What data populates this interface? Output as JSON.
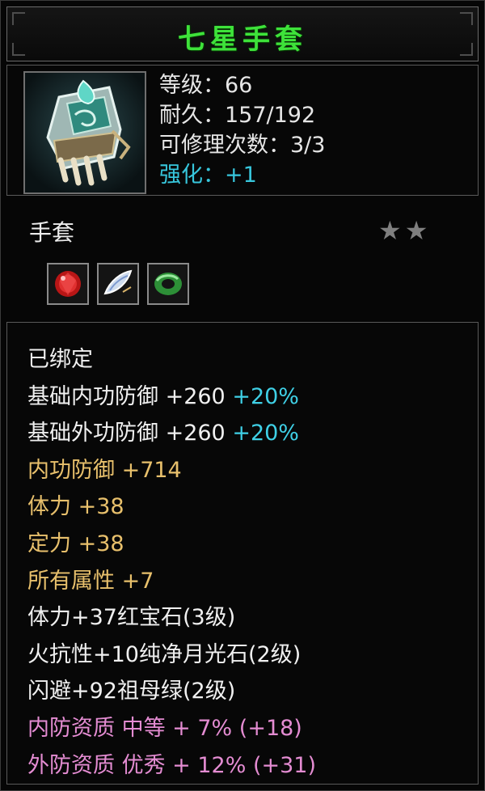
{
  "item": {
    "name": "七星手套",
    "icon": "gauntlet-icon",
    "level": "等级：66",
    "durability": "耐久：157/192",
    "repairs": "可修理次数：3/3",
    "enhance": "强化：+1",
    "type": "手套",
    "stars": "★★",
    "gems": [
      {
        "icon": "ruby-gem-icon",
        "color": "#d42222"
      },
      {
        "icon": "moonstone-gem-icon",
        "color": "#c9d6ea"
      },
      {
        "icon": "emerald-gem-icon",
        "color": "#3aa640"
      }
    ]
  },
  "props": {
    "bound": "已绑定",
    "base_inner_def": {
      "label": "基础内功防御 +260 ",
      "bonus": "+20%"
    },
    "base_outer_def": {
      "label": "基础外功防御 +260 ",
      "bonus": "+20%"
    },
    "inner_def": "内功防御 +714",
    "stamina": "体力 +38",
    "focus": "定力 +38",
    "all_attr": "所有属性 +7",
    "gem1": "体力+37红宝石(3级)",
    "gem2": "火抗性+10纯净月光石(2级)",
    "gem3": "闪避+92祖母绿(2级)",
    "quality_inner": "内防资质 中等 + 7% (+18)",
    "quality_outer": "外防资质 优秀 + 12% (+31)"
  },
  "colors": {
    "title": "#3ee23a",
    "cyan": "#37c6dc",
    "gold": "#e8c06c",
    "pink": "#e48cd2"
  }
}
